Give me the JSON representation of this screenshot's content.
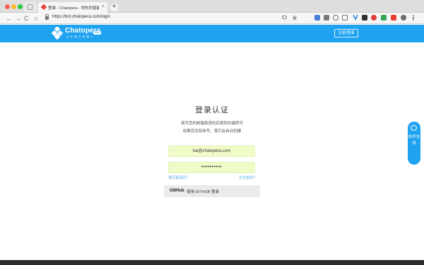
{
  "browser": {
    "tab_title": "登录 - Chatopera - 领先的智能",
    "tab_close": "×",
    "new_tab": "+",
    "url": "https://bot.chatopera.com/login",
    "nav": {
      "back": "←",
      "forward": "→",
      "reload": "C",
      "home": "⌂"
    }
  },
  "header": {
    "brand": "Chatopera",
    "tagline": "企 业 聊 天 机 器 人",
    "badge": "beta",
    "action_label": "注册/登录",
    "color": "#1fa2f0"
  },
  "login": {
    "title": "登录认证",
    "desc_line1": "填写您的邮箱和密码后按回车键即可",
    "desc_line2": "如果您没有帐号，我们会自动创建",
    "email_value": "kai@chatopera.com",
    "password_value": "••••••••••",
    "invite_link": "填写邀请码?",
    "forgot_link": "忘记密码?",
    "github_logo": "GitHub",
    "github_label": "使用 GITHUB 登录",
    "field_color": "#f0fcc8"
  },
  "support": {
    "label": "技术支持"
  }
}
